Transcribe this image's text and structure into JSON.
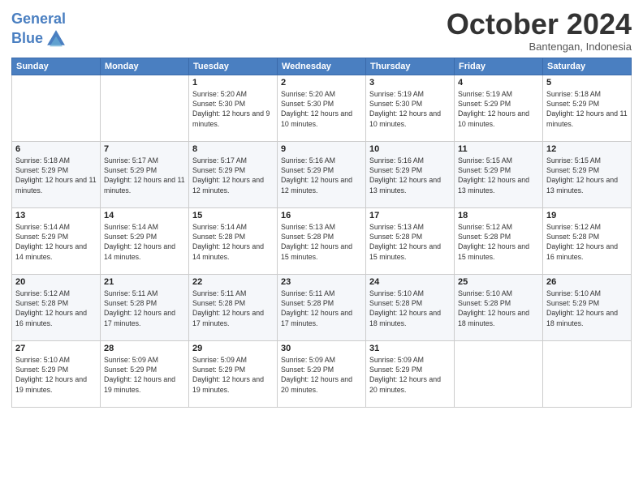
{
  "header": {
    "logo_line1": "General",
    "logo_line2": "Blue",
    "month": "October 2024",
    "location": "Bantengan, Indonesia"
  },
  "days_of_week": [
    "Sunday",
    "Monday",
    "Tuesday",
    "Wednesday",
    "Thursday",
    "Friday",
    "Saturday"
  ],
  "weeks": [
    [
      {
        "num": "",
        "info": ""
      },
      {
        "num": "",
        "info": ""
      },
      {
        "num": "1",
        "info": "Sunrise: 5:20 AM\nSunset: 5:30 PM\nDaylight: 12 hours and 9 minutes."
      },
      {
        "num": "2",
        "info": "Sunrise: 5:20 AM\nSunset: 5:30 PM\nDaylight: 12 hours and 10 minutes."
      },
      {
        "num": "3",
        "info": "Sunrise: 5:19 AM\nSunset: 5:30 PM\nDaylight: 12 hours and 10 minutes."
      },
      {
        "num": "4",
        "info": "Sunrise: 5:19 AM\nSunset: 5:29 PM\nDaylight: 12 hours and 10 minutes."
      },
      {
        "num": "5",
        "info": "Sunrise: 5:18 AM\nSunset: 5:29 PM\nDaylight: 12 hours and 11 minutes."
      }
    ],
    [
      {
        "num": "6",
        "info": "Sunrise: 5:18 AM\nSunset: 5:29 PM\nDaylight: 12 hours and 11 minutes."
      },
      {
        "num": "7",
        "info": "Sunrise: 5:17 AM\nSunset: 5:29 PM\nDaylight: 12 hours and 11 minutes."
      },
      {
        "num": "8",
        "info": "Sunrise: 5:17 AM\nSunset: 5:29 PM\nDaylight: 12 hours and 12 minutes."
      },
      {
        "num": "9",
        "info": "Sunrise: 5:16 AM\nSunset: 5:29 PM\nDaylight: 12 hours and 12 minutes."
      },
      {
        "num": "10",
        "info": "Sunrise: 5:16 AM\nSunset: 5:29 PM\nDaylight: 12 hours and 13 minutes."
      },
      {
        "num": "11",
        "info": "Sunrise: 5:15 AM\nSunset: 5:29 PM\nDaylight: 12 hours and 13 minutes."
      },
      {
        "num": "12",
        "info": "Sunrise: 5:15 AM\nSunset: 5:29 PM\nDaylight: 12 hours and 13 minutes."
      }
    ],
    [
      {
        "num": "13",
        "info": "Sunrise: 5:14 AM\nSunset: 5:29 PM\nDaylight: 12 hours and 14 minutes."
      },
      {
        "num": "14",
        "info": "Sunrise: 5:14 AM\nSunset: 5:29 PM\nDaylight: 12 hours and 14 minutes."
      },
      {
        "num": "15",
        "info": "Sunrise: 5:14 AM\nSunset: 5:28 PM\nDaylight: 12 hours and 14 minutes."
      },
      {
        "num": "16",
        "info": "Sunrise: 5:13 AM\nSunset: 5:28 PM\nDaylight: 12 hours and 15 minutes."
      },
      {
        "num": "17",
        "info": "Sunrise: 5:13 AM\nSunset: 5:28 PM\nDaylight: 12 hours and 15 minutes."
      },
      {
        "num": "18",
        "info": "Sunrise: 5:12 AM\nSunset: 5:28 PM\nDaylight: 12 hours and 15 minutes."
      },
      {
        "num": "19",
        "info": "Sunrise: 5:12 AM\nSunset: 5:28 PM\nDaylight: 12 hours and 16 minutes."
      }
    ],
    [
      {
        "num": "20",
        "info": "Sunrise: 5:12 AM\nSunset: 5:28 PM\nDaylight: 12 hours and 16 minutes."
      },
      {
        "num": "21",
        "info": "Sunrise: 5:11 AM\nSunset: 5:28 PM\nDaylight: 12 hours and 17 minutes."
      },
      {
        "num": "22",
        "info": "Sunrise: 5:11 AM\nSunset: 5:28 PM\nDaylight: 12 hours and 17 minutes."
      },
      {
        "num": "23",
        "info": "Sunrise: 5:11 AM\nSunset: 5:28 PM\nDaylight: 12 hours and 17 minutes."
      },
      {
        "num": "24",
        "info": "Sunrise: 5:10 AM\nSunset: 5:28 PM\nDaylight: 12 hours and 18 minutes."
      },
      {
        "num": "25",
        "info": "Sunrise: 5:10 AM\nSunset: 5:28 PM\nDaylight: 12 hours and 18 minutes."
      },
      {
        "num": "26",
        "info": "Sunrise: 5:10 AM\nSunset: 5:29 PM\nDaylight: 12 hours and 18 minutes."
      }
    ],
    [
      {
        "num": "27",
        "info": "Sunrise: 5:10 AM\nSunset: 5:29 PM\nDaylight: 12 hours and 19 minutes."
      },
      {
        "num": "28",
        "info": "Sunrise: 5:09 AM\nSunset: 5:29 PM\nDaylight: 12 hours and 19 minutes."
      },
      {
        "num": "29",
        "info": "Sunrise: 5:09 AM\nSunset: 5:29 PM\nDaylight: 12 hours and 19 minutes."
      },
      {
        "num": "30",
        "info": "Sunrise: 5:09 AM\nSunset: 5:29 PM\nDaylight: 12 hours and 20 minutes."
      },
      {
        "num": "31",
        "info": "Sunrise: 5:09 AM\nSunset: 5:29 PM\nDaylight: 12 hours and 20 minutes."
      },
      {
        "num": "",
        "info": ""
      },
      {
        "num": "",
        "info": ""
      }
    ]
  ]
}
